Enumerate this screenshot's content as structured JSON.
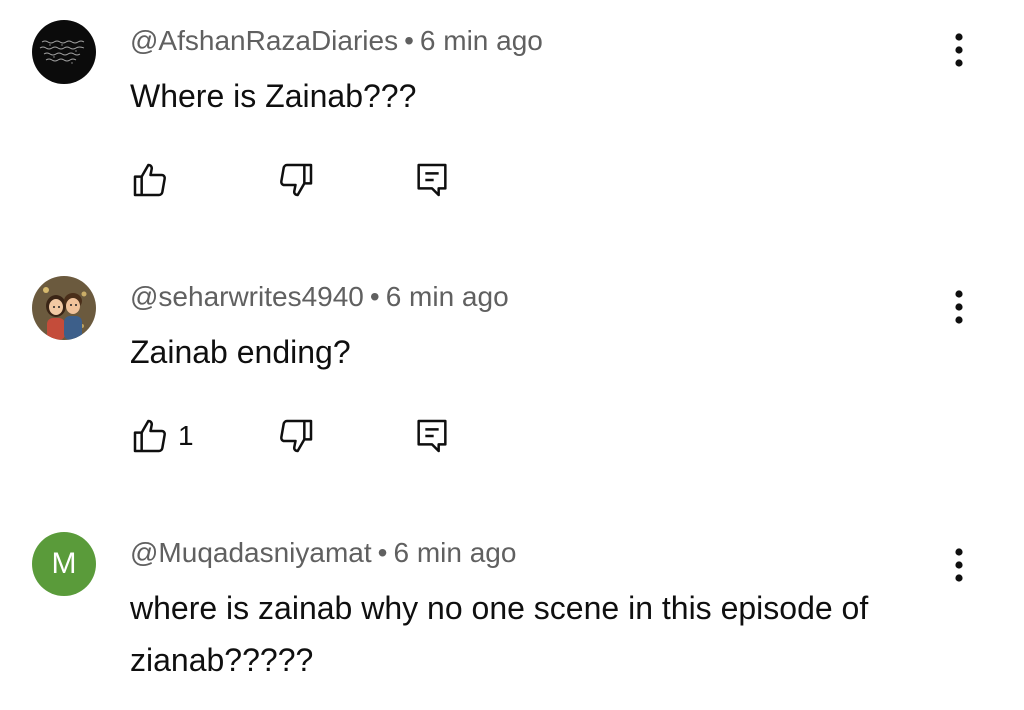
{
  "comments": [
    {
      "author": "@AfshanRazaDiaries",
      "separator": "•",
      "time": "6 min ago",
      "text": "Where is Zainab???",
      "likes": "",
      "avatar_icon": "dark-calligraphy-avatar"
    },
    {
      "author": "@seharwrites4940",
      "separator": "•",
      "time": "6 min ago",
      "text": "Zainab ending?",
      "likes": "1",
      "avatar_icon": "couple-cartoon-avatar"
    },
    {
      "author": "@Muqadasniyamat",
      "separator": "•",
      "time": "6 min ago",
      "text": "where is zainab why no one scene in this episode of zianab?????",
      "likes": "",
      "avatar_letter": "M",
      "avatar_color": "#5a9b3a"
    }
  ],
  "icons": {
    "like": "thumb-up-icon",
    "dislike": "thumb-down-icon",
    "reply": "reply-icon",
    "more": "more-vert-icon"
  }
}
